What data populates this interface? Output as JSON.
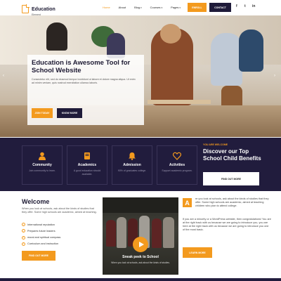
{
  "brand": {
    "title": "Education",
    "subtitle": "Element"
  },
  "nav": {
    "items": [
      {
        "label": "Home",
        "active": true,
        "dropdown": false
      },
      {
        "label": "About",
        "active": false,
        "dropdown": false
      },
      {
        "label": "Blog",
        "active": false,
        "dropdown": true
      },
      {
        "label": "Courses",
        "active": false,
        "dropdown": true
      },
      {
        "label": "Pages",
        "active": false,
        "dropdown": true
      }
    ],
    "enroll_label": "ENROLL",
    "contact_label": "CONTACT",
    "social": [
      "f",
      "t",
      "in"
    ]
  },
  "hero": {
    "title": "Education is Awesome Tool for School Website",
    "text": "Consectetur elit, sed do eiusmod tempor incididunt ut labore et dolore magna aliqua. Ut enim ad minim veniam, quis nostrud exercitation ullamco laboris.",
    "primary_button": "JOIN TODAY",
    "secondary_button": "KNOW MORE"
  },
  "features": [
    {
      "title": "Community",
      "desc": "Join community to learn.",
      "icon": "person-icon"
    },
    {
      "title": "Academics",
      "desc": "A good education should available.",
      "icon": "book-icon"
    },
    {
      "title": "Admission",
      "desc": "90% of graduates college.",
      "icon": "bell-icon"
    },
    {
      "title": "Activities",
      "desc": "Support academic program.",
      "icon": "heart-icon"
    }
  ],
  "welcome_band": {
    "tag": "YOU ARE WELCOME",
    "title": "Discover our Top School Child Benefits",
    "button": "FIND OUT MORE"
  },
  "welcome": {
    "title": "Welcome",
    "description": "When you look at schools, ask about the kinds of studies that they offer. Some high schools are academic, aimed at teaching.",
    "checklist": [
      "International reputation",
      "Prepares future leaders",
      "moral and spiritual compass",
      "Curriculum and instruction"
    ],
    "button": "FIND OUT MORE"
  },
  "video": {
    "title": "Sneak peek to School",
    "desc": "When you look at schools, ask about the kinds of studies."
  },
  "right_column": {
    "dropcap": "A",
    "paragraph1": "re you look at schools, ask about the kinds of studies that they offer. Some high schools are academic, aimed at teaching children who plan to attend college.",
    "paragraph2": "If you are a minority or a WordPress website, then congratulations! You are at the right track with us because we are going to introduce you, you are here at the right track with us because we are going to introduce you one of the most basic.",
    "button": "LEARN MORE"
  },
  "colors": {
    "accent": "#f39a1e",
    "dark": "#211c3d",
    "navy": "#1f1b3a"
  }
}
